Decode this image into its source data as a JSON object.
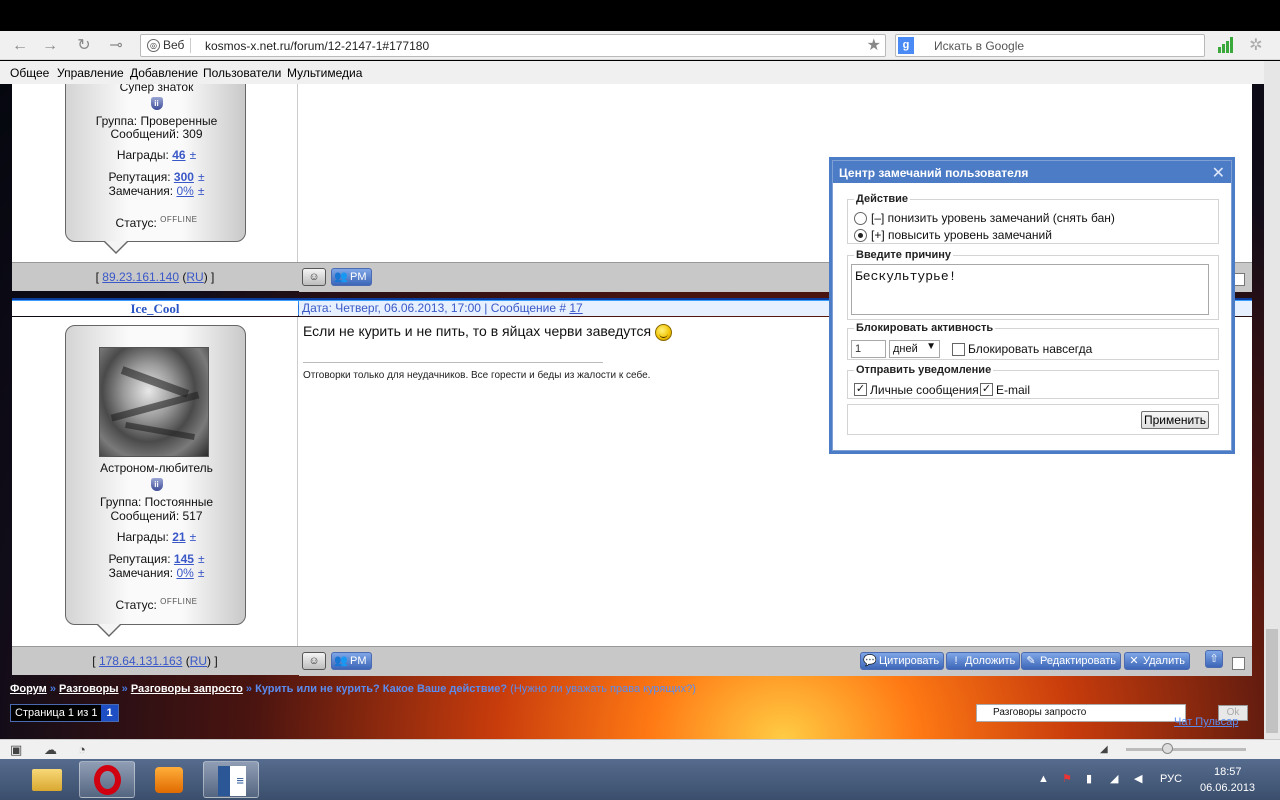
{
  "browser": {
    "site_label": "Веб",
    "url": "kosmos-x.net.ru/forum/12-2147-1#177180",
    "search_placeholder": "Искать в Google"
  },
  "menu": [
    "Общее",
    "Управление",
    "Добавление",
    "Пользователи",
    "Мультимедиа"
  ],
  "post1": {
    "rank": "Супер знаток",
    "group": "Группа: Проверенные",
    "messages": "Сообщений: 309",
    "awards_label": "Награды:",
    "awards": "46",
    "rep_label": "Репутация:",
    "rep": "300",
    "warn_label": "Замечания:",
    "warn": "0%",
    "status_label": "Статус:",
    "status": "OFFLINE",
    "ip": "89.23.161.140",
    "country": "RU",
    "pm": "PM"
  },
  "post2": {
    "nick": "Ice_Cool",
    "header_info": "Дата: Четверг, 06.06.2013, 17:00 | Сообщение #",
    "msg_num": "17",
    "rank": "Астроном-любитель",
    "group": "Группа: Постоянные",
    "messages": "Сообщений: 517",
    "awards_label": "Награды:",
    "awards": "21",
    "rep_label": "Репутация:",
    "rep": "145",
    "warn_label": "Замечания:",
    "warn": "0%",
    "status_label": "Статус:",
    "status": "OFFLINE",
    "text": "Если не курить и не пить, то в яйцах черви заведутся",
    "signature": "Отговорки только для неудачников. Все горести и беды из жалости к себе.",
    "ip": "178.64.131.163",
    "country": "RU",
    "pm": "PM",
    "quote": "Цитировать",
    "report": "Доложить",
    "edit": "Редактировать",
    "delete": "Удалить"
  },
  "modal": {
    "title": "Центр замечаний пользователя",
    "action_legend": "Действие",
    "option_decrease": "[–] понизить уровень замечаний (снять бан)",
    "option_increase": "[+] повысить уровень замечаний",
    "selected": "increase",
    "reason_legend": "Введите причину",
    "reason_value": "Бескультурье!",
    "block_legend": "Блокировать активность",
    "days_value": "1",
    "unit_value": "дней",
    "block_forever": "Блокировать навсегда",
    "notify_legend": "Отправить уведомление",
    "notify_pm": "Личные сообщения",
    "notify_email": "E-mail",
    "apply": "Применить"
  },
  "breadcrumb": {
    "forum": "Форум",
    "sep": "»",
    "section": "Разговоры",
    "subsection": "Разговоры запросто",
    "topic": "Курить или не курить? Какое Ваше действие?",
    "topic_hint": "(Нужно ли уважать права курящих?)"
  },
  "pager": {
    "text": "Страница 1 из 1",
    "page": "1"
  },
  "forum_select": "Разговоры запросто",
  "ok": "Ok",
  "chat_link": "Чат Пульсар",
  "tray": {
    "lang": "РУС",
    "time": "18:57",
    "date": "06.06.2013"
  }
}
